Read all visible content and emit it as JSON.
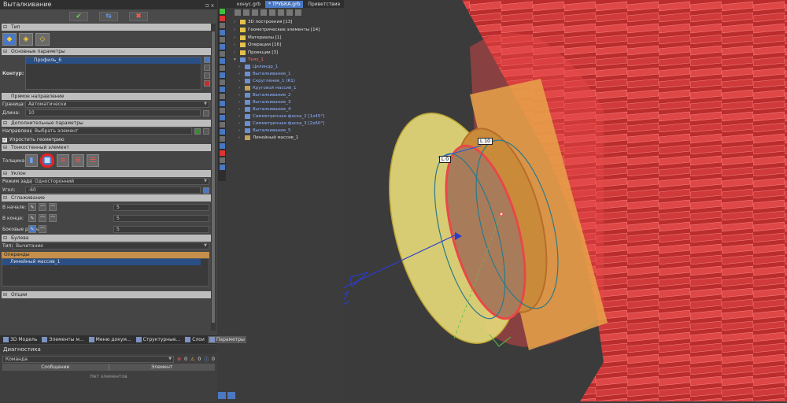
{
  "left_panel": {
    "title": "Выталкивание",
    "pin": "⊐ x",
    "ok": "✔",
    "apply": "⇆",
    "cancel": "✖",
    "type_section": "Тип",
    "main_params": "Основные параметры",
    "contour_label": "Контур:",
    "contour_item": "Профиль_6",
    "forward": "Прямое направление",
    "boundary_label": "Граница:",
    "boundary_value": "Автоматически",
    "length_label": "Длина:",
    "length_value": "10",
    "extra_params": "Дополнительные параметры",
    "direction_label": "Направление:",
    "direction_value": "Выбрать элемент",
    "simplify": "Упростить геометрию",
    "thin_wall": "Тонкостенный элемент",
    "thickness_label": "Толщина:",
    "slope": "Уклон",
    "mode_label": "Режим задания:",
    "mode_value": "Односторонний",
    "angle_label": "Угол:",
    "angle_value": "-60",
    "smoothing": "Сглаживание",
    "start_label": "В начале:",
    "start_value": "5",
    "end_label": "В конце:",
    "end_value": "5",
    "side_label": "Боковые рёбра:",
    "side_value": "5",
    "boolean": "Булева",
    "btype_label": "Тип:",
    "btype_value": "Вычитание",
    "operands": "Операнды",
    "op_item": "Линейный массив_1",
    "op_empty": "- - -",
    "options": "Опции"
  },
  "bottom_tabs": [
    {
      "label": "3D Модель"
    },
    {
      "label": "Элементы м..."
    },
    {
      "label": "Меню докум..."
    },
    {
      "label": "Структурные..."
    },
    {
      "label": "Слои"
    },
    {
      "label": "Параметры"
    }
  ],
  "diagnostics": {
    "title": "Диагностика",
    "command_label": "Команда",
    "err": "0",
    "warn": "0",
    "info": "0",
    "col_message": "Сообщение",
    "col_element": "Элемент",
    "empty": "Нет элементов"
  },
  "doc_tabs": [
    {
      "label": "конус.grb"
    },
    {
      "label": "* ТРУБКА.grb"
    },
    {
      "label": "Приветствие"
    }
  ],
  "tree": [
    {
      "label": "3D построения [13]"
    },
    {
      "label": "Геометрические элементы [14]"
    },
    {
      "label": "Материалы [1]"
    },
    {
      "label": "Операции [16]"
    },
    {
      "label": "Проекции [3]"
    },
    {
      "label": "Тело_1"
    },
    {
      "label": "Цилиндр_1"
    },
    {
      "label": "Выталкивание_1"
    },
    {
      "label": "Скругление_1 (R1)"
    },
    {
      "label": "Круговой массив_1"
    },
    {
      "label": "Выталкивание_2"
    },
    {
      "label": "Выталкивание_3"
    },
    {
      "label": "Выталкивание_4"
    },
    {
      "label": "Симметричная фаска_2 [1x45°]"
    },
    {
      "label": "Симметричная фаска_3 [2x60°]"
    },
    {
      "label": "Выталкивание_5"
    },
    {
      "label": "Линейный массив_1"
    }
  ],
  "dims": {
    "d1": "L 10",
    "d2": "L 0"
  },
  "colors": {
    "body_red": "#e03c3c",
    "ring_orange": "#e8a34a",
    "cone_yellow": "#e8dc7a",
    "accent": "#4a78c2"
  }
}
